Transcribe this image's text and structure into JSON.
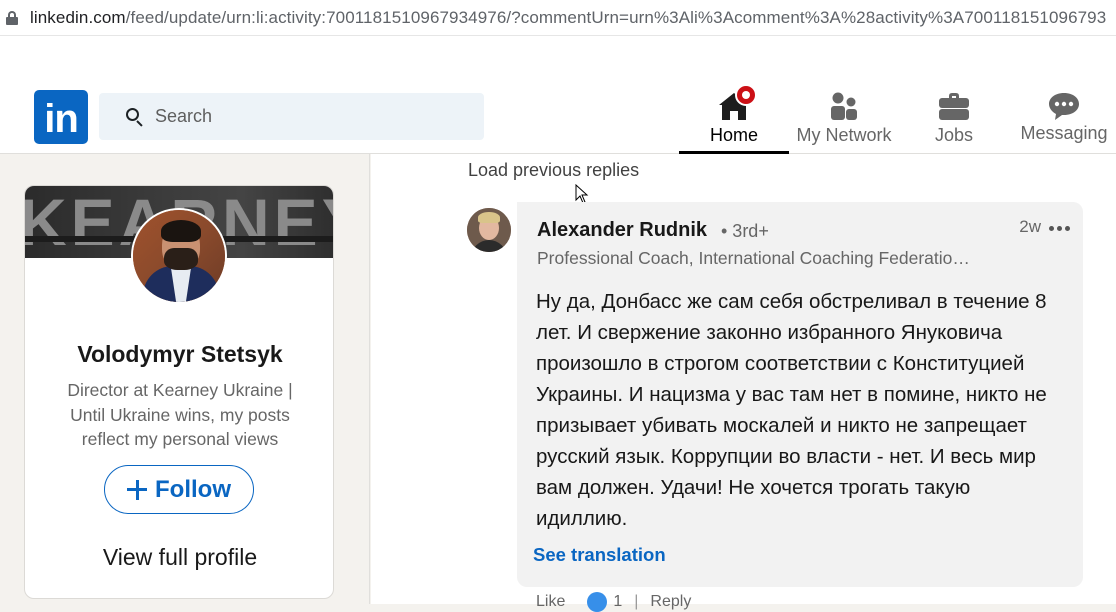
{
  "browser": {
    "url_host": "linkedin.com",
    "url_rest": "/feed/update/urn:li:activity:7001181510967934976/?commentUrn=urn%3Ali%3Acomment%3A%28activity%3A700118151096793"
  },
  "header": {
    "logo": "in",
    "search_placeholder": "Search",
    "nav": [
      {
        "label": "Home",
        "icon": "home-icon",
        "active": true
      },
      {
        "label": "My Network",
        "icon": "network-icon",
        "active": false
      },
      {
        "label": "Jobs",
        "icon": "briefcase-icon",
        "active": false
      },
      {
        "label": "Messaging",
        "icon": "messaging-icon",
        "active": false
      }
    ]
  },
  "profile_card": {
    "cover_text": "KEARNEY",
    "name": "Volodymyr Stetsyk",
    "headline": "Director at Kearney Ukraine | Until Ukraine wins, my posts reflect my personal views",
    "follow_label": "Follow",
    "view_profile_label": "View full profile"
  },
  "comments": {
    "load_previous": "Load previous replies",
    "comment": {
      "author": "Alexander Rudnik",
      "degree": "• 3rd+",
      "time": "2w",
      "headline": "Professional Coach, International Coaching Federatio…",
      "text": "Ну да, Донбасс же сам себя обстреливал в течение 8 лет. И свержение законно избранного Януковича произошло в строгом соответствии с Конституцией Украины. И нацизма у вас там нет в помине, никто не призывает убивать москалей и никто не запрещает русский язык. Коррупции во власти - нет. И весь мир вам должен. Удачи! Не хочется трогать такую идиллию.",
      "see_translation": "See translation",
      "like_label": "Like",
      "reaction_count": "1",
      "reply_label": "Reply"
    }
  },
  "colors": {
    "brand_blue": "#0a66c2",
    "notification_red": "#cc1016",
    "bubble_bg": "#f2f2f2"
  }
}
